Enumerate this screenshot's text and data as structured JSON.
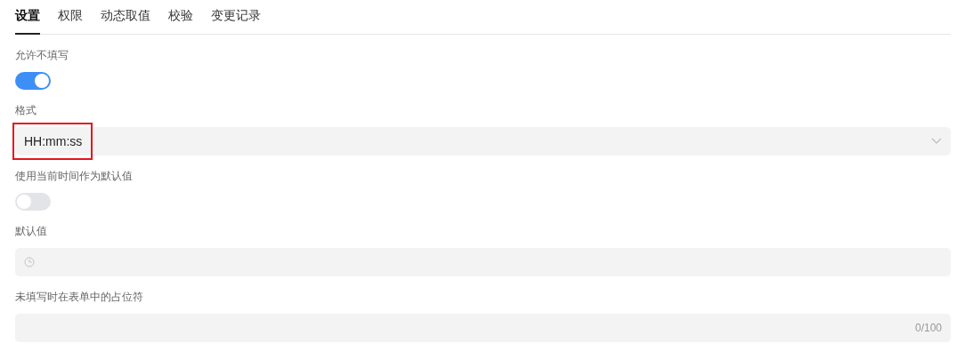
{
  "tabs": [
    {
      "label": "设置",
      "selected": true
    },
    {
      "label": "权限",
      "selected": false
    },
    {
      "label": "动态取值",
      "selected": false
    },
    {
      "label": "校验",
      "selected": false
    },
    {
      "label": "变更记录",
      "selected": false
    }
  ],
  "fields": [
    {
      "kind": "toggle",
      "label": "允许不填写",
      "on": true
    },
    {
      "kind": "select",
      "label": "格式",
      "value": "HH:mm:ss",
      "highlighted": true
    },
    {
      "kind": "toggle",
      "label": "使用当前时间作为默认值",
      "on": false
    },
    {
      "kind": "time",
      "label": "默认值"
    },
    {
      "kind": "text",
      "label": "未填写时在表单中的占位符",
      "counter": "0/100"
    }
  ]
}
